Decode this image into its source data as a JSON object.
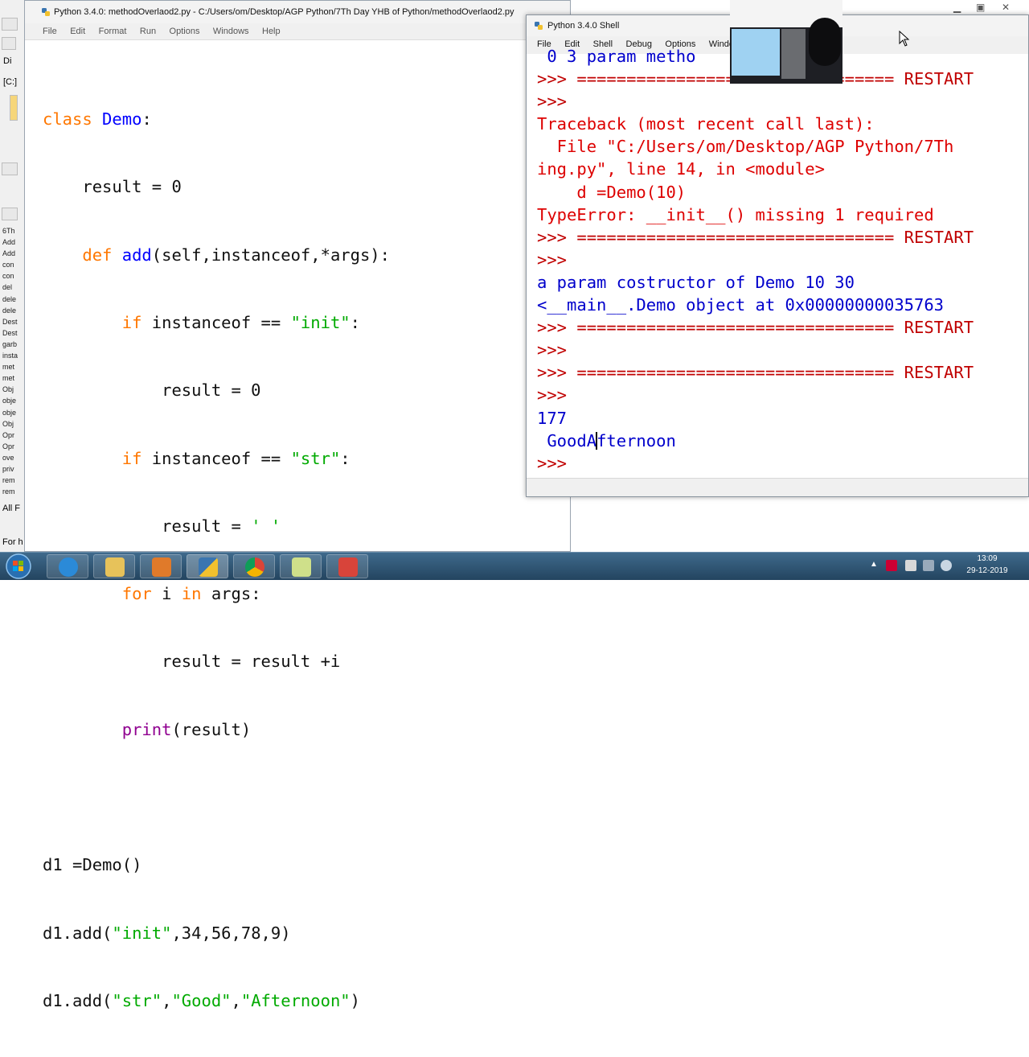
{
  "editor": {
    "title": "Python 3.4.0: methodOverlaod2.py - C:/Users/om/Desktop/AGP Python/7Th Day YHB of Python/methodOverlaod2.py",
    "menu": [
      "File",
      "Edit",
      "Format",
      "Run",
      "Options",
      "Windows",
      "Help"
    ],
    "code": {
      "l1": {
        "kw": "class",
        "name": " Demo",
        "rest": ":"
      },
      "l2": "    result = 0",
      "l3": {
        "indent": "    ",
        "kw": "def",
        "name": " add",
        "rest": "(self,instanceof,*args):"
      },
      "l4": {
        "indent": "        ",
        "kw": "if",
        "rest": " instanceof == ",
        "str": "\"init\"",
        "end": ":"
      },
      "l5": "            result = 0",
      "l6": {
        "indent": "        ",
        "kw": "if",
        "rest": " instanceof == ",
        "str": "\"str\"",
        "end": ":"
      },
      "l7": {
        "indent": "            result = ",
        "str": "' '"
      },
      "l8": {
        "indent": "        ",
        "kw": "for",
        "mid": " i ",
        "kw2": "in",
        "rest": " args:"
      },
      "l9": "            result = result +i",
      "l10": {
        "indent": "        ",
        "bi": "print",
        "rest": "(result)"
      },
      "l12": "d1 =Demo()",
      "l13": {
        "a": "d1.add(",
        "s1": "\"init\"",
        "b": ",34,56,78,9)"
      },
      "l14": {
        "a": "d1.add(",
        "s1": "\"str\"",
        "c1": ",",
        "s2": "\"Good\"",
        "c2": ",",
        "s3": "\"Afternoon\"",
        "b": ")"
      }
    }
  },
  "shell": {
    "title": "Python 3.4.0 Shell",
    "menu": [
      "File",
      "Edit",
      "Shell",
      "Debug",
      "Options",
      "Windows"
    ],
    "lines": [
      {
        "cls": "stdout",
        "text": " 0 3 param metho"
      },
      {
        "cls": "prompt",
        "text": ">>> ================================ RESTART"
      },
      {
        "cls": "prompt",
        "text": ">>>"
      },
      {
        "cls": "red",
        "text": "Traceback (most recent call last):"
      },
      {
        "cls": "red",
        "text": "  File \"C:/Users/om/Desktop/AGP Python/7Th"
      },
      {
        "cls": "red",
        "text": "ing.py\", line 14, in <module>"
      },
      {
        "cls": "red",
        "text": "    d =Demo(10)"
      },
      {
        "cls": "red",
        "text": "TypeError: __init__() missing 1 required"
      },
      {
        "cls": "prompt",
        "text": ">>> ================================ RESTART"
      },
      {
        "cls": "prompt",
        "text": ">>>"
      },
      {
        "cls": "stdout",
        "text": "a param costructor of Demo 10 30"
      },
      {
        "cls": "stdout",
        "text": "<__main__.Demo object at 0x00000000035763"
      },
      {
        "cls": "prompt",
        "text": ">>> ================================ RESTART"
      },
      {
        "cls": "prompt",
        "text": ">>>"
      },
      {
        "cls": "prompt",
        "text": ">>> ================================ RESTART"
      },
      {
        "cls": "prompt",
        "text": ">>>"
      },
      {
        "cls": "stdout",
        "text": "177"
      }
    ],
    "out_pre": " GoodA",
    "out_post": "fternoon",
    "last_prompt": ">>>"
  },
  "left_files": [
    "6Th",
    "Add",
    "Add",
    "con",
    "con",
    "del",
    "dele",
    "dele",
    "Dest",
    "Dest",
    "garb",
    "insta",
    "met",
    "met",
    "Obj",
    "obje",
    "obje",
    "Obj",
    "Opr",
    "Opr",
    "ove",
    "priv",
    "rem",
    "rem"
  ],
  "left_labels": {
    "di": "Di",
    "c": "[C:]",
    "all": "All F",
    "for": "For h"
  },
  "taskbar": {
    "time": "13:09",
    "date": "29-12-2019"
  },
  "colors": {
    "keyword": "#ff7700",
    "string": "#00aa00",
    "builtin": "#900090",
    "definition": "#0000ff",
    "error": "#dd0000",
    "stdout": "#0000cc"
  }
}
